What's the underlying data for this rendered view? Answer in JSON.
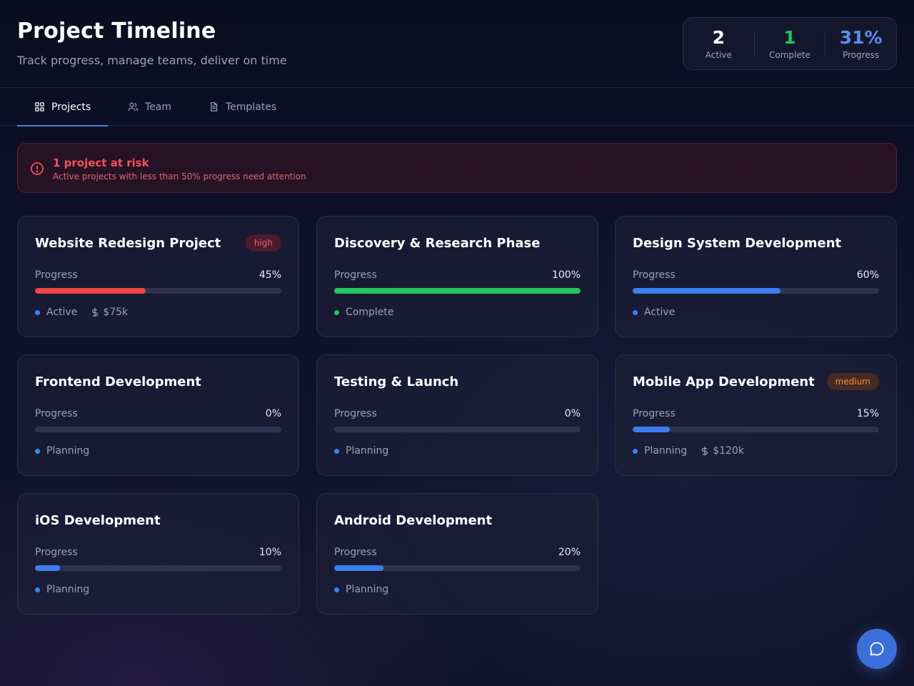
{
  "header": {
    "title": "Project Timeline",
    "subtitle": "Track progress, manage teams, deliver on time"
  },
  "stats": [
    {
      "value": "2",
      "label": "Active",
      "color": "#ffffff"
    },
    {
      "value": "1",
      "label": "Complete",
      "color": "#22c55e"
    },
    {
      "value": "31%",
      "label": "Progress",
      "color": "#5b8def"
    }
  ],
  "tabs": [
    {
      "label": "Projects",
      "icon": "grid-icon",
      "active": true
    },
    {
      "label": "Team",
      "icon": "users-icon",
      "active": false
    },
    {
      "label": "Templates",
      "icon": "document-icon",
      "active": false
    }
  ],
  "alert": {
    "title": "1 project at risk",
    "description": "Active projects with less than 50% progress need attention",
    "icon": "alert-circle-icon"
  },
  "progress_label": "Progress",
  "projects": [
    {
      "title": "Website Redesign Project",
      "badge": "high",
      "progress": 45,
      "progress_text": "45%",
      "bar_color": "#ef4444",
      "status": "Active",
      "status_color": "#3b82f6",
      "budget": "$75k"
    },
    {
      "title": "Discovery & Research Phase",
      "badge": "",
      "progress": 100,
      "progress_text": "100%",
      "bar_color": "#22c55e",
      "status": "Complete",
      "status_color": "#22c55e",
      "budget": ""
    },
    {
      "title": "Design System Development",
      "badge": "",
      "progress": 60,
      "progress_text": "60%",
      "bar_color": "#3b7ef0",
      "status": "Active",
      "status_color": "#3b82f6",
      "budget": ""
    },
    {
      "title": "Frontend Development",
      "badge": "",
      "progress": 0,
      "progress_text": "0%",
      "bar_color": "#3b7ef0",
      "status": "Planning",
      "status_color": "#3b82f6",
      "budget": ""
    },
    {
      "title": "Testing & Launch",
      "badge": "",
      "progress": 0,
      "progress_text": "0%",
      "bar_color": "#3b7ef0",
      "status": "Planning",
      "status_color": "#3b82f6",
      "budget": ""
    },
    {
      "title": "Mobile App Development",
      "badge": "medium",
      "progress": 15,
      "progress_text": "15%",
      "bar_color": "#3b7ef0",
      "status": "Planning",
      "status_color": "#3b82f6",
      "budget": "$120k"
    },
    {
      "title": "iOS Development",
      "badge": "",
      "progress": 10,
      "progress_text": "10%",
      "bar_color": "#3b7ef0",
      "status": "Planning",
      "status_color": "#3b82f6",
      "budget": ""
    },
    {
      "title": "Android Development",
      "badge": "",
      "progress": 20,
      "progress_text": "20%",
      "bar_color": "#3b7ef0",
      "status": "Planning",
      "status_color": "#3b82f6",
      "budget": ""
    }
  ],
  "chat_button": {
    "icon": "chat-bubble-icon"
  }
}
